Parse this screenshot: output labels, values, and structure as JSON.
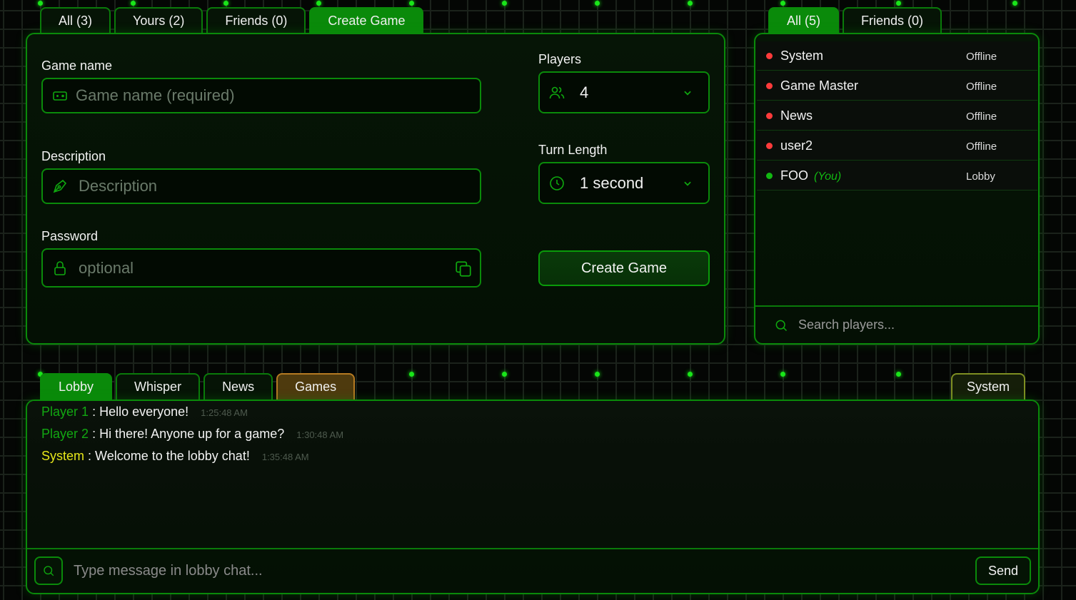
{
  "game_tabs": [
    {
      "label": "All (3)"
    },
    {
      "label": "Yours (2)"
    },
    {
      "label": "Friends (0)"
    },
    {
      "label": "Create Game",
      "active": true
    }
  ],
  "create_form": {
    "game_name_label": "Game name",
    "game_name_placeholder": "Game name (required)",
    "description_label": "Description",
    "description_placeholder": "Description",
    "password_label": "Password",
    "password_placeholder": "optional",
    "players_label": "Players",
    "players_value": "4",
    "turn_length_label": "Turn Length",
    "turn_length_value": "1 second",
    "create_button": "Create Game"
  },
  "player_tabs": [
    {
      "label": "All (5)",
      "active": true
    },
    {
      "label": "Friends (0)"
    }
  ],
  "players": [
    {
      "name": "System",
      "status": "Offline",
      "online": false
    },
    {
      "name": "Game Master",
      "status": "Offline",
      "online": false
    },
    {
      "name": "News",
      "status": "Offline",
      "online": false
    },
    {
      "name": "user2",
      "status": "Offline",
      "online": false
    },
    {
      "name": "FOO",
      "you": "(You)",
      "status": "Lobby",
      "online": true
    }
  ],
  "player_search_placeholder": "Search players...",
  "chat_tabs": [
    {
      "label": "Lobby",
      "active": true
    },
    {
      "label": "Whisper"
    },
    {
      "label": "News"
    },
    {
      "label": "Games"
    }
  ],
  "chat_tab_system": "System",
  "messages": [
    {
      "sender": "Player 1",
      "text": ": Hello everyone!",
      "time": "1:25:48 AM"
    },
    {
      "sender": "Player 2",
      "text": ": Hi there! Anyone up for a game?",
      "time": "1:30:48 AM"
    },
    {
      "sender": "System",
      "text": ": Welcome to the lobby chat!",
      "time": "1:35:48 AM"
    }
  ],
  "chat_input_placeholder": "Type message in lobby chat...",
  "send_button": "Send",
  "colors": {
    "accent": "#0a8a0a",
    "online": "#12b812",
    "offline": "#ff3b3b",
    "system": "#e6e61a",
    "games_tab": "#b57a22"
  }
}
